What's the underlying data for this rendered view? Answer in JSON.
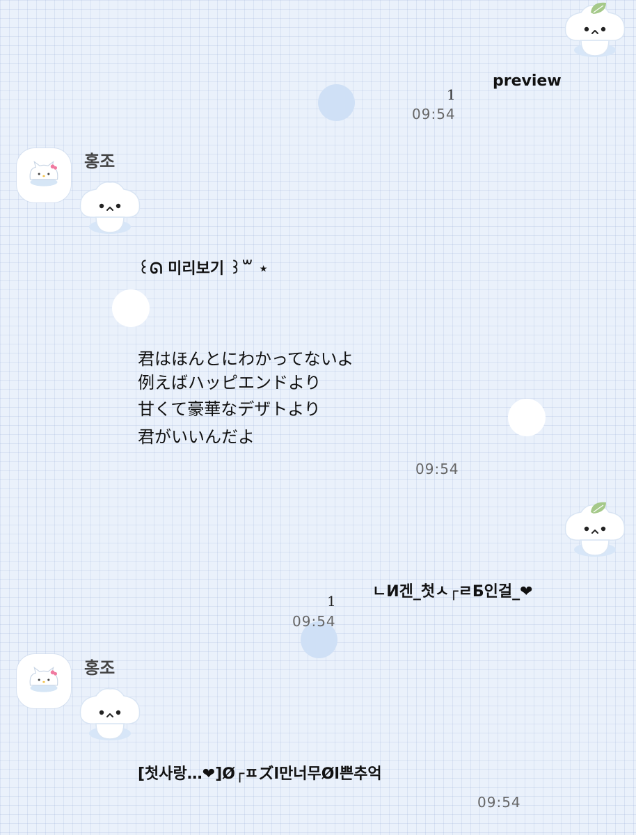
{
  "chat": {
    "messages": [
      {
        "type": "outgoing",
        "text": "preview",
        "unread": "1",
        "time": "09:54"
      },
      {
        "type": "incoming",
        "sender": "홍조",
        "title": "꒰ᘏ 미리보기 ꒱꒳ ⋆",
        "lyrics": [
          "君はほんとにわかってないよ",
          "例えばハッピエンドより",
          "甘くて豪華なデザトより",
          "君がいいんだよ"
        ],
        "time": "09:54"
      },
      {
        "type": "outgoing",
        "text": "ㄴИ겐_첫ㅅ┌ㄹБ인걸_❤",
        "unread": "1",
        "time": "09:54"
      },
      {
        "type": "incoming",
        "sender": "홍조",
        "text": "[첫사랑…❤]Ø┌ㅍズl만너무Øl쁜추억",
        "time": "09:54"
      }
    ]
  },
  "icons": {
    "sticker": "mushroom-sticker-icon",
    "avatar": "kitty-avatar-icon"
  },
  "colors": {
    "background": "#eaf1fb",
    "grid": "#c5d4ea",
    "dot_blue": "#cfe0f6",
    "leaf": "#a5c98a"
  }
}
